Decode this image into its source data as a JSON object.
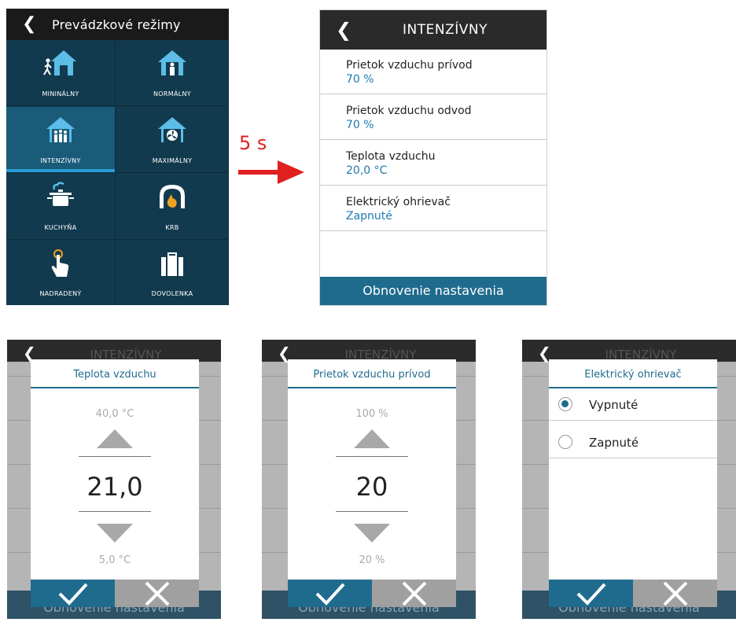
{
  "modes_screen": {
    "title": "Prevádzkové režimy",
    "tiles": [
      {
        "label": "MININÁLNY",
        "icon": "walking-person-house-icon"
      },
      {
        "label": "NORMÁLNY",
        "icon": "person-house-icon"
      },
      {
        "label": "INTENZÍVNY",
        "icon": "group-house-icon",
        "selected": true
      },
      {
        "label": "MAXIMÁLNY",
        "icon": "fan-house-icon"
      },
      {
        "label": "KUCHYŇA",
        "icon": "cooking-pot-icon"
      },
      {
        "label": "KRB",
        "icon": "fireplace-icon"
      },
      {
        "label": "NADRADENÝ",
        "icon": "touch-hand-icon"
      },
      {
        "label": "DOVOLENKA",
        "icon": "suitcase-icon"
      }
    ]
  },
  "transition": {
    "label": "5 s"
  },
  "intensive_screen": {
    "title": "INTENZÍVNY",
    "rows": [
      {
        "label": "Prietok vzduchu prívod",
        "value": "70 %"
      },
      {
        "label": "Prietok vzduchu odvod",
        "value": "70 %"
      },
      {
        "label": "Teplota vzduchu",
        "value": "20,0 °C"
      },
      {
        "label": "Elektrický ohrievač",
        "value": "Zapnuté"
      }
    ],
    "footer": "Obnovenie nastavenia"
  },
  "background_screen": {
    "title": "INTENZÍVNY",
    "footer": "Obnovenie nastavenia"
  },
  "dialog_temp": {
    "title": "Teplota vzduchu",
    "max": "40,0 °C",
    "value": "21,0",
    "min": "5,0 °C"
  },
  "dialog_flow": {
    "title": "Prietok vzduchu prívod",
    "max": "100 %",
    "value": "20",
    "min": "20 %"
  },
  "dialog_heater": {
    "title": "Elektrický ohrievač",
    "options": [
      {
        "label": "Vypnuté",
        "selected": true
      },
      {
        "label": "Zapnuté",
        "selected": false
      }
    ]
  },
  "colors": {
    "accent": "#1f6b8e",
    "highlight": "#2a9bd8",
    "arrow": "#e02020",
    "tile_bg": "#123a4e"
  }
}
